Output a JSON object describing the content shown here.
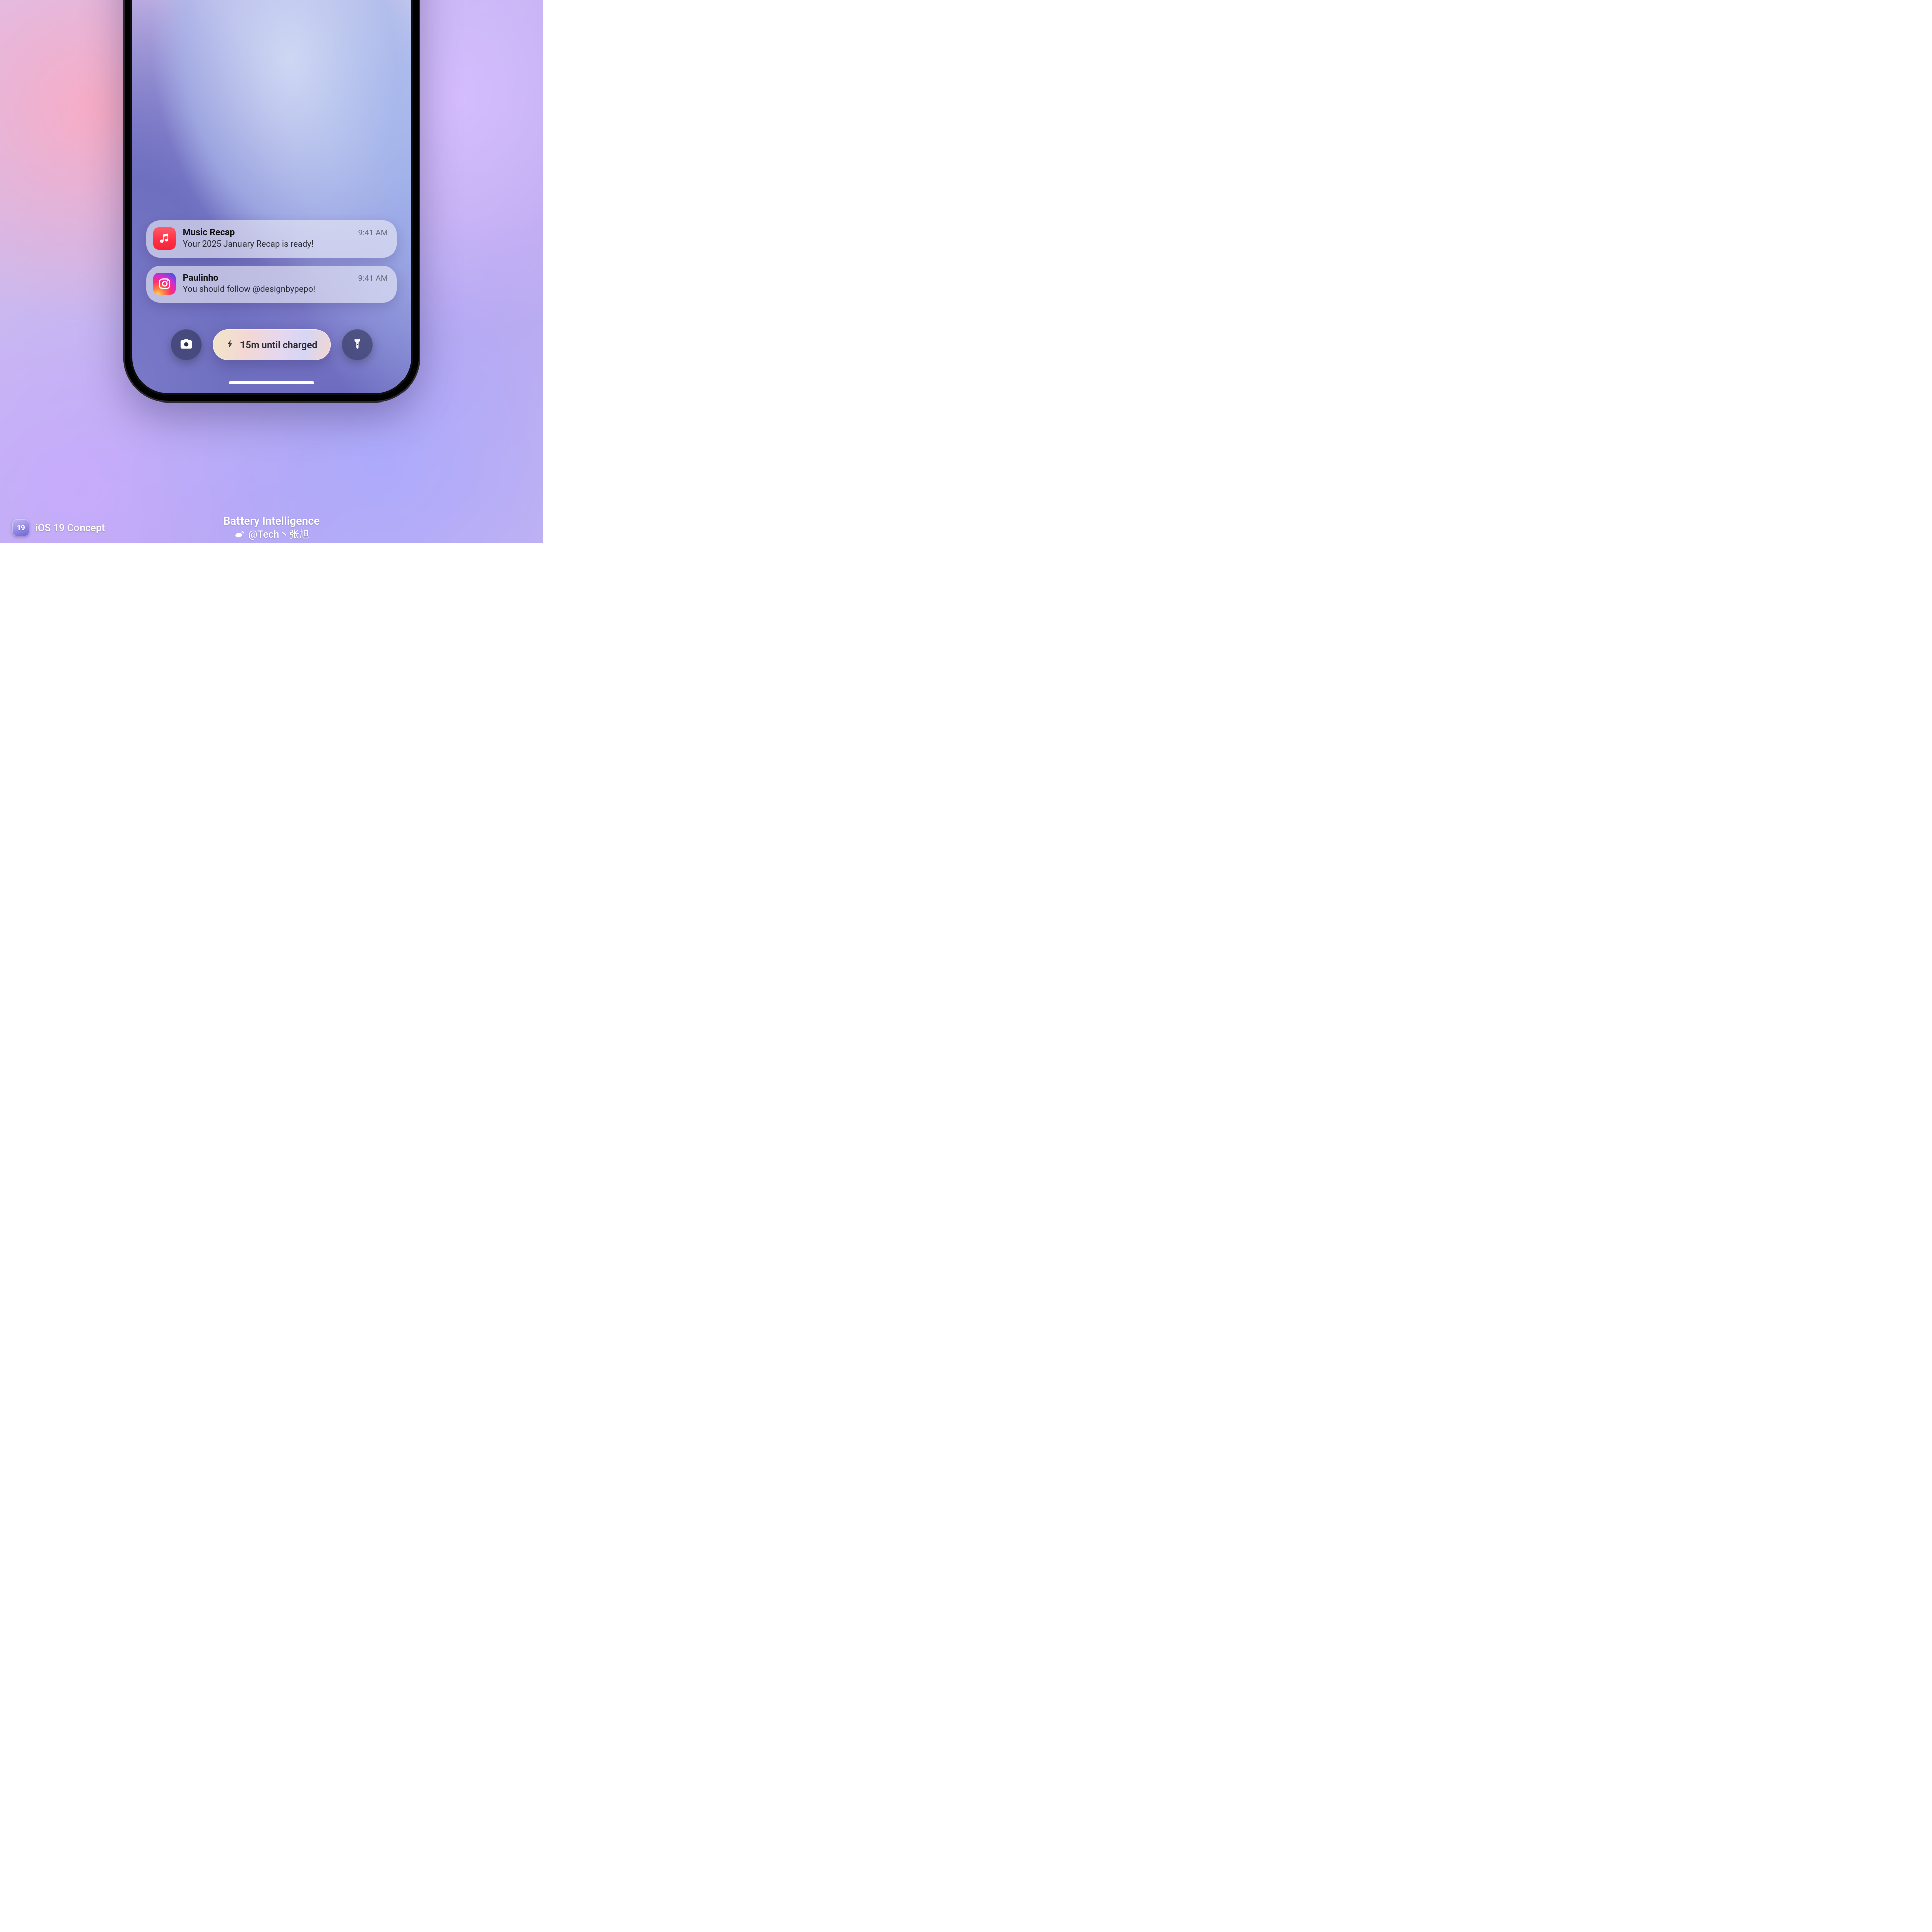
{
  "notifications": [
    {
      "app": "music",
      "title": "Music Recap",
      "time": "9:41 AM",
      "body": "Your 2025 January Recap is ready!"
    },
    {
      "app": "instagram",
      "title": "Paulinho",
      "time": "9:41 AM",
      "body": "You should follow @designbypepo!"
    }
  ],
  "charge_status": "15m until charged",
  "caption": {
    "badge": "19",
    "left": "iOS 19 Concept",
    "center_title": "Battery Intelligence",
    "center_handle": "@Tech丶张旭"
  }
}
